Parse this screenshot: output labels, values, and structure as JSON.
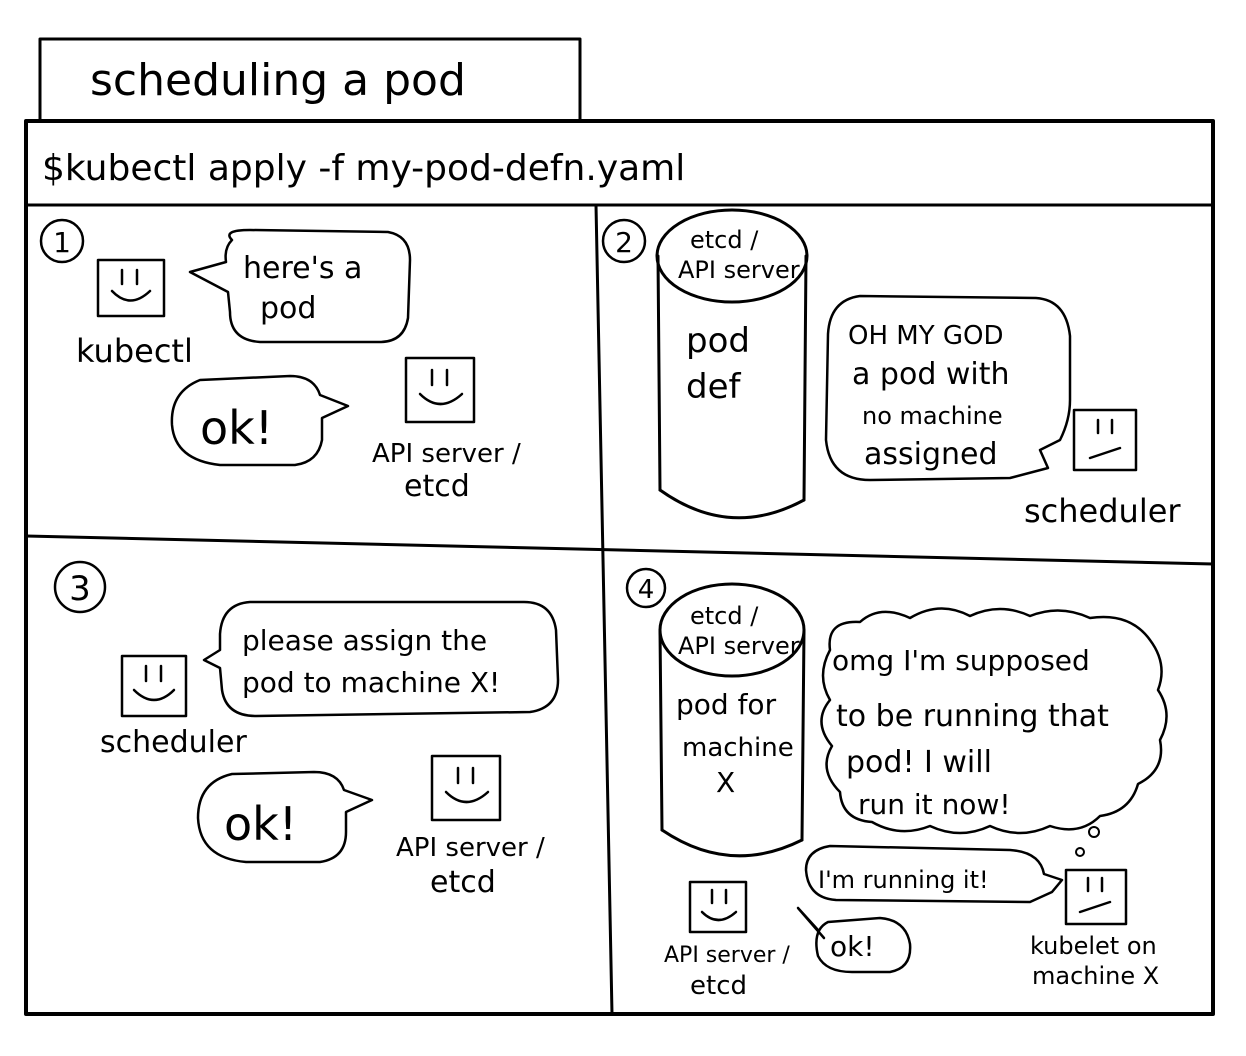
{
  "title": "scheduling a pod",
  "command": "$kubectl apply -f my-pod-defn.yaml",
  "panels": [
    {
      "number": "1",
      "bubbles": [
        "here's a",
        "pod",
        "ok!"
      ],
      "labels": [
        "kubectl",
        "API server /",
        "etcd"
      ]
    },
    {
      "number": "2",
      "cylinder_top": [
        "etcd /",
        "API server"
      ],
      "cylinder_body": [
        "pod",
        "def"
      ],
      "bubble": [
        "OH MY GOD",
        "a pod with",
        "no machine",
        "assigned"
      ],
      "labels": [
        "scheduler"
      ]
    },
    {
      "number": "3",
      "bubbles": [
        "please assign the",
        "pod to machine X!",
        "ok!"
      ],
      "labels": [
        "scheduler",
        "API server /",
        "etcd"
      ]
    },
    {
      "number": "4",
      "cylinder_top": [
        "etcd /",
        "API server"
      ],
      "cylinder_body": [
        "pod for",
        "machine",
        "X"
      ],
      "thought": [
        "omg I'm supposed",
        "to be running that",
        "pod! I will",
        "run it now!"
      ],
      "bubbles": [
        "I'm running it!",
        "ok!"
      ],
      "labels": [
        "API server /",
        "etcd",
        "kubelet on",
        "machine X"
      ]
    }
  ]
}
